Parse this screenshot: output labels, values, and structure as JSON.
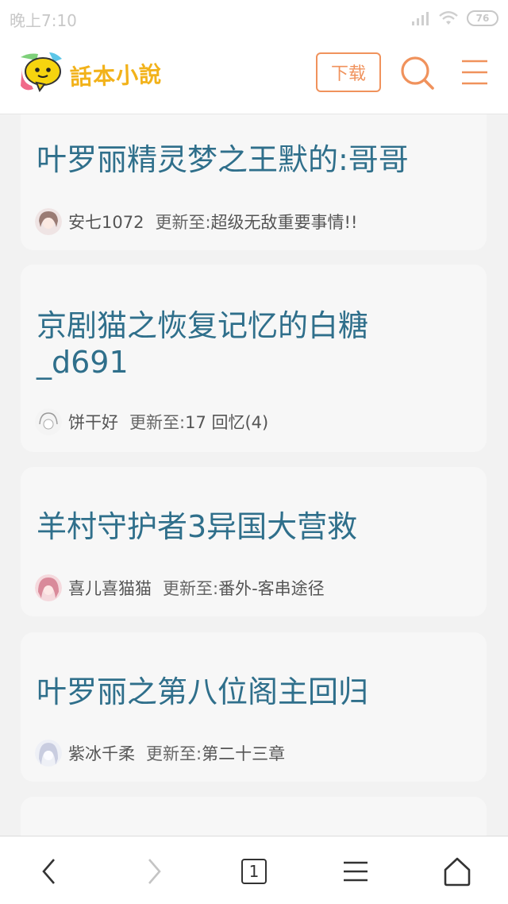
{
  "status_bar": {
    "time": "晚上7:10",
    "battery": "76"
  },
  "header": {
    "logo_text": "話本小說",
    "download_label": "下载"
  },
  "books": [
    {
      "title": "叶罗丽精灵梦之王默的:哥哥",
      "author": "安七1072",
      "update_label": "更新至:",
      "update_value": "超级无敌重要事情!!"
    },
    {
      "title": "京剧猫之恢复记忆的白糖_d691",
      "author": "饼干好",
      "update_label": "更新至:",
      "update_value": "17 回忆(4)"
    },
    {
      "title": "羊村守护者3异国大营救",
      "author": "喜儿喜猫猫",
      "update_label": "更新至:",
      "update_value": "番外-客串途径"
    },
    {
      "title": "叶罗丽之第八位阁主回归",
      "author": "紫冰千柔",
      "update_label": "更新至:",
      "update_value": "第二十三章"
    }
  ],
  "bottom_nav": {
    "tab_count": "1"
  },
  "colors": {
    "accent": "#f0925c",
    "title": "#2f6f8b",
    "logo": "#f2b21a"
  }
}
